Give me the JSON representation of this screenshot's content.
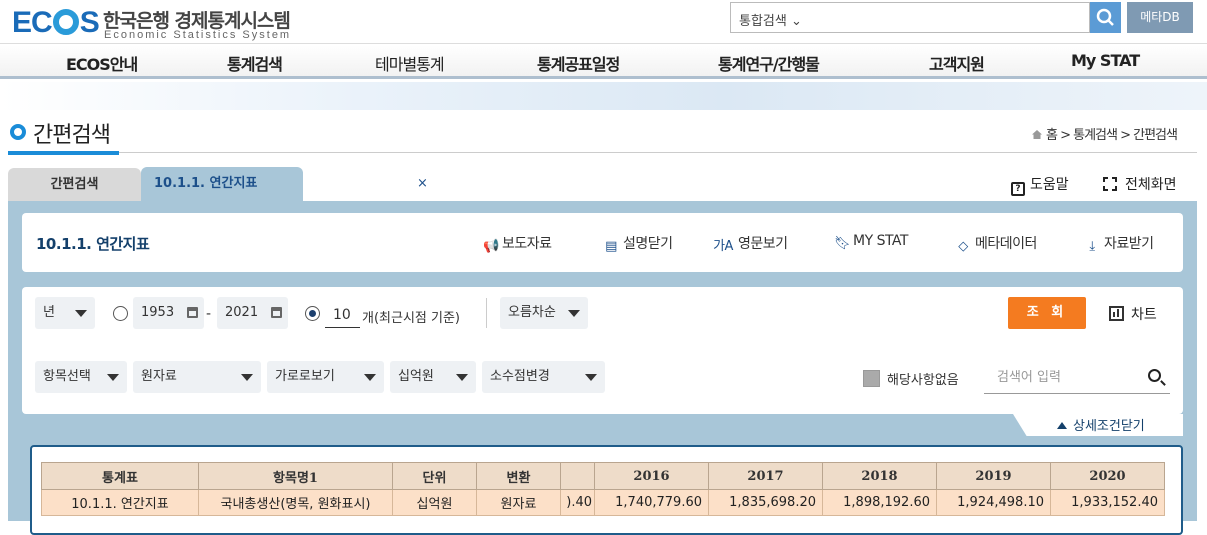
{
  "header": {
    "logo_text": "ECOS",
    "site_name_ko": "한국은행 경제통계시스템",
    "site_name_en": "Economic Statistics System",
    "search_scope": "통합검색",
    "metadb_label": "메타DB"
  },
  "nav": [
    "ECOS안내",
    "통계검색",
    "테마별통계",
    "통계공표일정",
    "통계연구/간행물",
    "고객지원",
    "My STAT"
  ],
  "page": {
    "title": "간편검색",
    "breadcrumb": "홈 > 통계검색 > 간편검색"
  },
  "tabs": {
    "simple": "간편검색",
    "annual": "10.1.1. 연간지표",
    "close": "×",
    "help": "도움말",
    "fullscreen": "전체화면"
  },
  "stat": {
    "title": "10.1.1. 연간지표",
    "tools": [
      "보도자료",
      "설명닫기",
      "영문보기",
      "MY STAT",
      "메타데이터",
      "자료받기"
    ]
  },
  "controls": {
    "period": "년",
    "year_from": "1953",
    "dash": "-",
    "year_to": "2021",
    "count": "10",
    "count_label": "개(최근시점 기준)",
    "order": "오름차순",
    "query_btn": "조 회",
    "chart_btn": "차트",
    "item_select": "항목선택",
    "data_type": "원자료",
    "view": "가로로보기",
    "unit": "십억원",
    "decimal": "소수점변경",
    "na_label": "해당사항없음",
    "keyword_placeholder": "검색어 입력",
    "detail_toggle": "상세조건닫기"
  },
  "table": {
    "headers": [
      "통계표",
      "항목명1",
      "단위",
      "변환",
      "",
      "2016",
      "2017",
      "2018",
      "2019",
      "2020"
    ],
    "rows": [
      [
        "10.1.1. 연간지표",
        "국내총생산(명목, 원화표시)",
        "십억원",
        "원자료",
        ").40",
        "1,740,779.60",
        "1,835,698.20",
        "1,898,192.60",
        "1,924,498.10",
        "1,933,152.40"
      ]
    ]
  },
  "colors": {
    "brand_blue": "#1a6bb8",
    "panel_blue": "#a8c6d8",
    "query_orange": "#f47b20",
    "table_header": "#eedcc9",
    "table_row": "#fce0c8"
  }
}
